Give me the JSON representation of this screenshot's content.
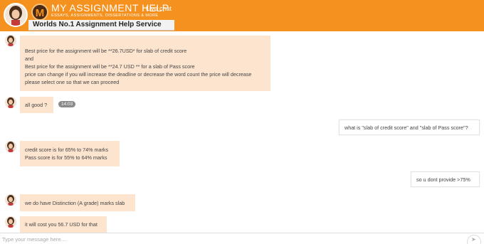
{
  "header": {
    "brand_title": "MY ASSIGNMENT HELP",
    "brand_subtitle": "ESSAYS, ASSIGNMENTS, DISSERTATIONS & MORE",
    "logo_letter": "M",
    "live_chat_label": "Live chat",
    "tagline": "Worlds No.1 Assignment Help Service",
    "accent_color": "#f5911e"
  },
  "messages": [
    {
      "sender": "agent",
      "lines": [
        "Best price for the assignment will be **26.7USD* for slab of credit score",
        "and",
        "Best price for the assignment will be **24.7 USD ** for a slab of Pass score",
        "price can change if you will increase the deadline or decrease the word count the price will decrease",
        "please select one so that we can proceed"
      ]
    },
    {
      "sender": "agent",
      "lines": [
        "all good ?"
      ],
      "timestamp": "14:03"
    },
    {
      "sender": "user",
      "lines": [
        "what is \"slab of credit score\" and \"slab of Pass score\"?"
      ]
    },
    {
      "sender": "agent",
      "lines": [
        "credit score is for 65% to 74% marks",
        "Pass score is for 55% to 64% marks"
      ]
    },
    {
      "sender": "user",
      "lines": [
        "so u dont provide >75%"
      ]
    },
    {
      "sender": "agent",
      "lines": [
        "we do have Distinction (A grade) marks slab"
      ]
    },
    {
      "sender": "agent",
      "lines": [
        "it will cost you 56.7 USD for that"
      ]
    }
  ],
  "input": {
    "placeholder": "Type your message here...."
  }
}
